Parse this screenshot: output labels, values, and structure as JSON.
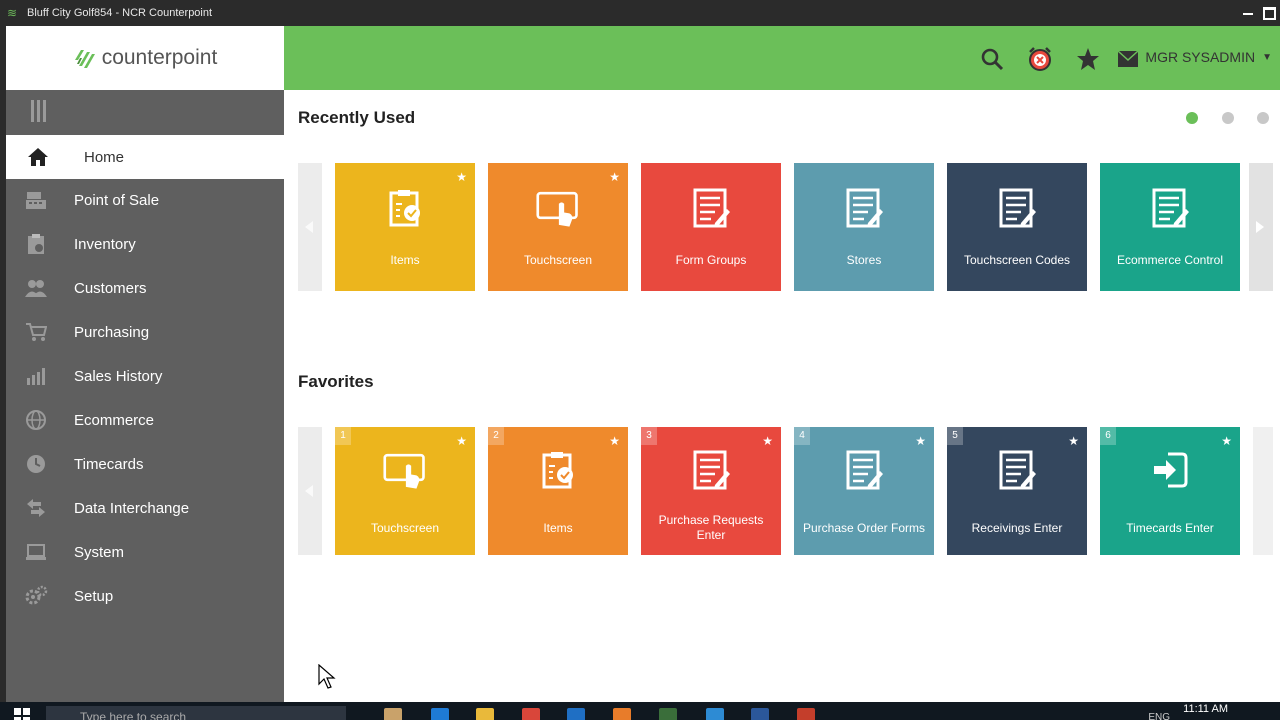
{
  "window": {
    "title": "Bluff City Golf854 - NCR Counterpoint"
  },
  "logo": {
    "text": "counterpoint"
  },
  "topbar": {
    "user_label": "MGR SYSADMIN"
  },
  "sidebar": {
    "items": [
      {
        "label": "Home",
        "icon": "home-icon"
      },
      {
        "label": "Point of Sale",
        "icon": "register-icon"
      },
      {
        "label": "Inventory",
        "icon": "clipboard-icon"
      },
      {
        "label": "Customers",
        "icon": "people-icon"
      },
      {
        "label": "Purchasing",
        "icon": "cart-icon"
      },
      {
        "label": "Sales History",
        "icon": "bar-chart-icon"
      },
      {
        "label": "Ecommerce",
        "icon": "globe-icon"
      },
      {
        "label": "Timecards",
        "icon": "clock-icon"
      },
      {
        "label": "Data Interchange",
        "icon": "arrows-icon"
      },
      {
        "label": "System",
        "icon": "laptop-icon"
      },
      {
        "label": "Setup",
        "icon": "gears-icon"
      }
    ]
  },
  "recent": {
    "title": "Recently Used",
    "tiles": [
      {
        "label": "Items",
        "color": "#ecb51d",
        "icon": "clipboard-check-icon",
        "starred": true
      },
      {
        "label": "Touchscreen",
        "color": "#ef8a2c",
        "icon": "touchscreen-icon",
        "starred": true
      },
      {
        "label": "Form Groups",
        "color": "#e8493e",
        "icon": "form-icon",
        "starred": false
      },
      {
        "label": "Stores",
        "color": "#5d9cae",
        "icon": "form-icon",
        "starred": false
      },
      {
        "label": "Touchscreen Codes",
        "color": "#34475e",
        "icon": "form-icon",
        "starred": false
      },
      {
        "label": "Ecommerce Control",
        "color": "#1aa48a",
        "icon": "form-icon",
        "starred": false
      }
    ]
  },
  "favorites": {
    "title": "Favorites",
    "tiles": [
      {
        "num": "1",
        "label": "Touchscreen",
        "color": "#ecb51d",
        "icon": "touchscreen-icon"
      },
      {
        "num": "2",
        "label": "Items",
        "color": "#ef8a2c",
        "icon": "clipboard-check-icon"
      },
      {
        "num": "3",
        "label": "Purchase Requests Enter",
        "color": "#e8493e",
        "icon": "form-icon"
      },
      {
        "num": "4",
        "label": "Purchase Order Forms",
        "color": "#5d9cae",
        "icon": "form-icon"
      },
      {
        "num": "5",
        "label": "Receivings Enter",
        "color": "#34475e",
        "icon": "form-icon"
      },
      {
        "num": "6",
        "label": "Timecards Enter",
        "color": "#1aa48a",
        "icon": "sign-in-icon"
      }
    ]
  },
  "taskbar": {
    "search_placeholder": "Type here to search",
    "time": "11:11 AM",
    "lang": "ENG"
  }
}
